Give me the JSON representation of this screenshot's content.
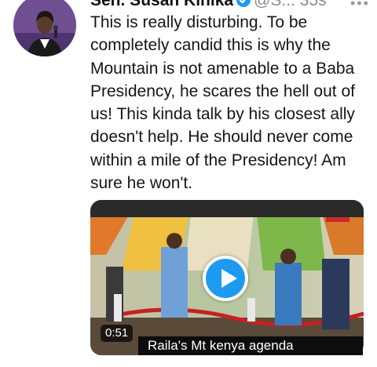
{
  "tweet": {
    "display_name": "Sen. Susan Kihika",
    "verified": true,
    "handle": "@S...",
    "time": "35s",
    "more_icon": "more-dots-icon",
    "text": "This is really disturbing. To be completely candid this is why the Mountain is not amenable to a Baba Presidency, he scares the hell out of us! This kinda talk by his closest ally doesn't help. He should never come within a mile of the Presidency! Am sure he won't."
  },
  "media": {
    "type": "video",
    "play_icon": "play-icon",
    "duration": "0:51",
    "caption": "Raila's Mt kenya agenda"
  },
  "colors": {
    "accent": "#1d9bf0",
    "text": "#151515",
    "muted": "#8a8a8a"
  }
}
